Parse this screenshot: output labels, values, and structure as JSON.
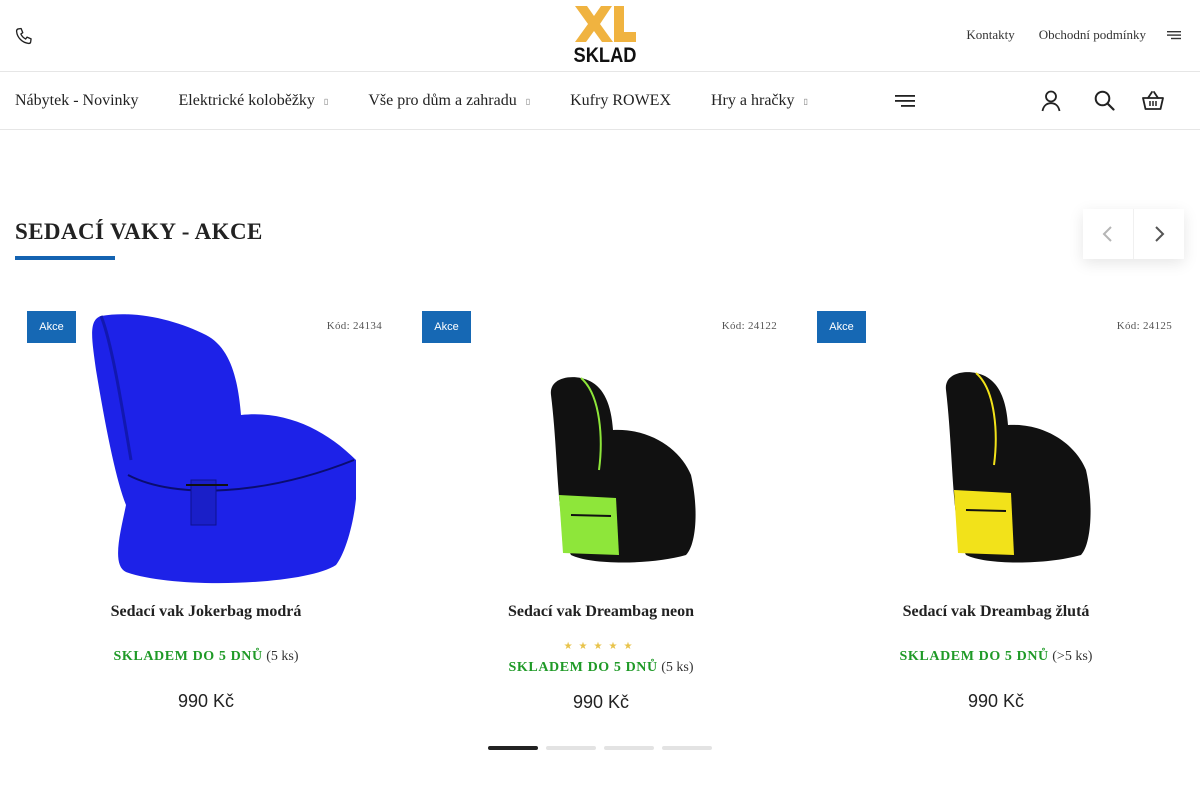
{
  "header": {
    "logo_text_top": "XL",
    "logo_text_bottom": "SKLAD",
    "links": [
      "Kontakty",
      "Obchodní podmínky"
    ]
  },
  "nav": {
    "items": [
      {
        "label": "Nábytek - Novinky",
        "has_dropdown": false
      },
      {
        "label": "Elektrické koloběžky",
        "has_dropdown": true
      },
      {
        "label": "Vše pro dům a zahradu",
        "has_dropdown": true
      },
      {
        "label": "Kufry ROWEX",
        "has_dropdown": false
      },
      {
        "label": "Hry a hračky",
        "has_dropdown": true
      }
    ],
    "caret": "▯"
  },
  "section": {
    "title": "SEDACÍ VAKY - AKCE"
  },
  "products": [
    {
      "badge": "Akce",
      "code": "Kód: 24134",
      "name": "Sedací vak Jokerbag modrá",
      "stock_status": "SKLADEM DO 5 DNŮ",
      "stock_count": "(5 ks)",
      "price": "990 Kč",
      "rating_stars": null,
      "color": "#1d22e8"
    },
    {
      "badge": "Akce",
      "code": "Kód: 24122",
      "name": "Sedací vak Dreambag neon",
      "stock_status": "SKLADEM DO 5 DNŮ",
      "stock_count": "(5 ks)",
      "price": "990 Kč",
      "rating_stars": "★★★★★",
      "color": "#8ee63a"
    },
    {
      "badge": "Akce",
      "code": "Kód: 24125",
      "name": "Sedací vak Dreambag žlutá",
      "stock_status": "SKLADEM DO 5 DNŮ",
      "stock_count": "(>5 ks)",
      "price": "990 Kč",
      "rating_stars": null,
      "color": "#f2e21a"
    }
  ],
  "pager": {
    "pages": 4,
    "active_index": 0
  },
  "colors": {
    "accent": "#1463b1",
    "badge": "#1668b4",
    "stock": "#1f9a27",
    "logo": "#f0b340"
  }
}
